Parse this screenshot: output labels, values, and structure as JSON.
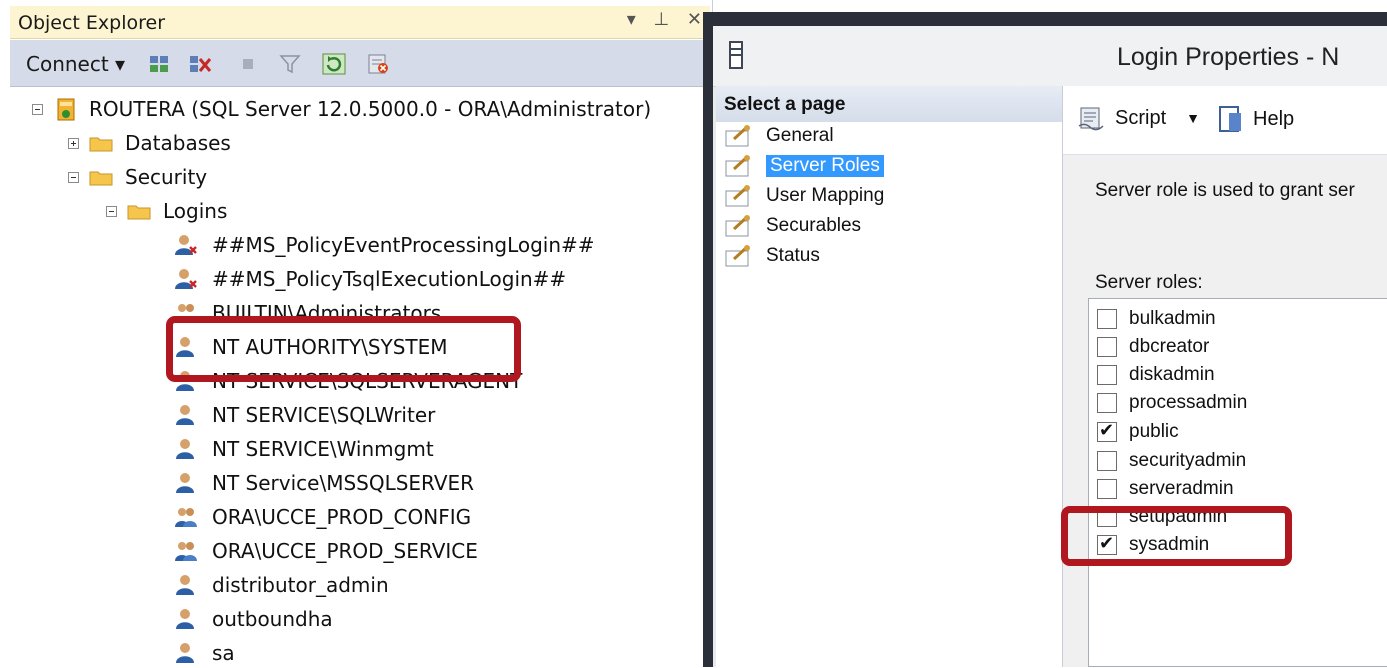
{
  "object_explorer": {
    "title": "Object Explorer",
    "title_buttons": "▾ ⊥ ✕",
    "toolbar": {
      "connect_label": "Connect ▾"
    },
    "tree": {
      "server": "ROUTERA (SQL Server 12.0.5000.0 - ORA\\Administrator)",
      "databases": "Databases",
      "security": "Security",
      "logins": "Logins",
      "login_items": [
        "##MS_PolicyEventProcessingLogin##",
        "##MS_PolicyTsqlExecutionLogin##",
        "BUILTIN\\Administrators",
        "NT AUTHORITY\\SYSTEM",
        "NT SERVICE\\SQLSERVERAGENT",
        "NT SERVICE\\SQLWriter",
        "NT SERVICE\\Winmgmt",
        "NT Service\\MSSQLSERVER",
        "ORA\\UCCE_PROD_CONFIG",
        "ORA\\UCCE_PROD_SERVICE",
        "distributor_admin",
        "outboundha",
        "sa"
      ]
    }
  },
  "dialog": {
    "title": "Login Properties - N",
    "select_page_header": "Select a page",
    "pages": [
      "General",
      "Server Roles",
      "User Mapping",
      "Securables",
      "Status"
    ],
    "selected_page": "Server Roles",
    "script_label": "Script",
    "help_label": "Help",
    "description": "Server role is used to grant ser",
    "server_roles_label": "Server roles:",
    "roles": [
      {
        "name": "bulkadmin",
        "checked": false
      },
      {
        "name": "dbcreator",
        "checked": false
      },
      {
        "name": "diskadmin",
        "checked": false
      },
      {
        "name": "processadmin",
        "checked": false
      },
      {
        "name": "public",
        "checked": true
      },
      {
        "name": "securityadmin",
        "checked": false
      },
      {
        "name": "serveradmin",
        "checked": false
      },
      {
        "name": "setupadmin",
        "checked": false
      },
      {
        "name": "sysadmin",
        "checked": true
      }
    ]
  },
  "colors": {
    "highlight": "#b0171f",
    "selection": "#3399ff",
    "toolbar": "#d6dbe9",
    "title_bar": "#fdf5d2"
  }
}
